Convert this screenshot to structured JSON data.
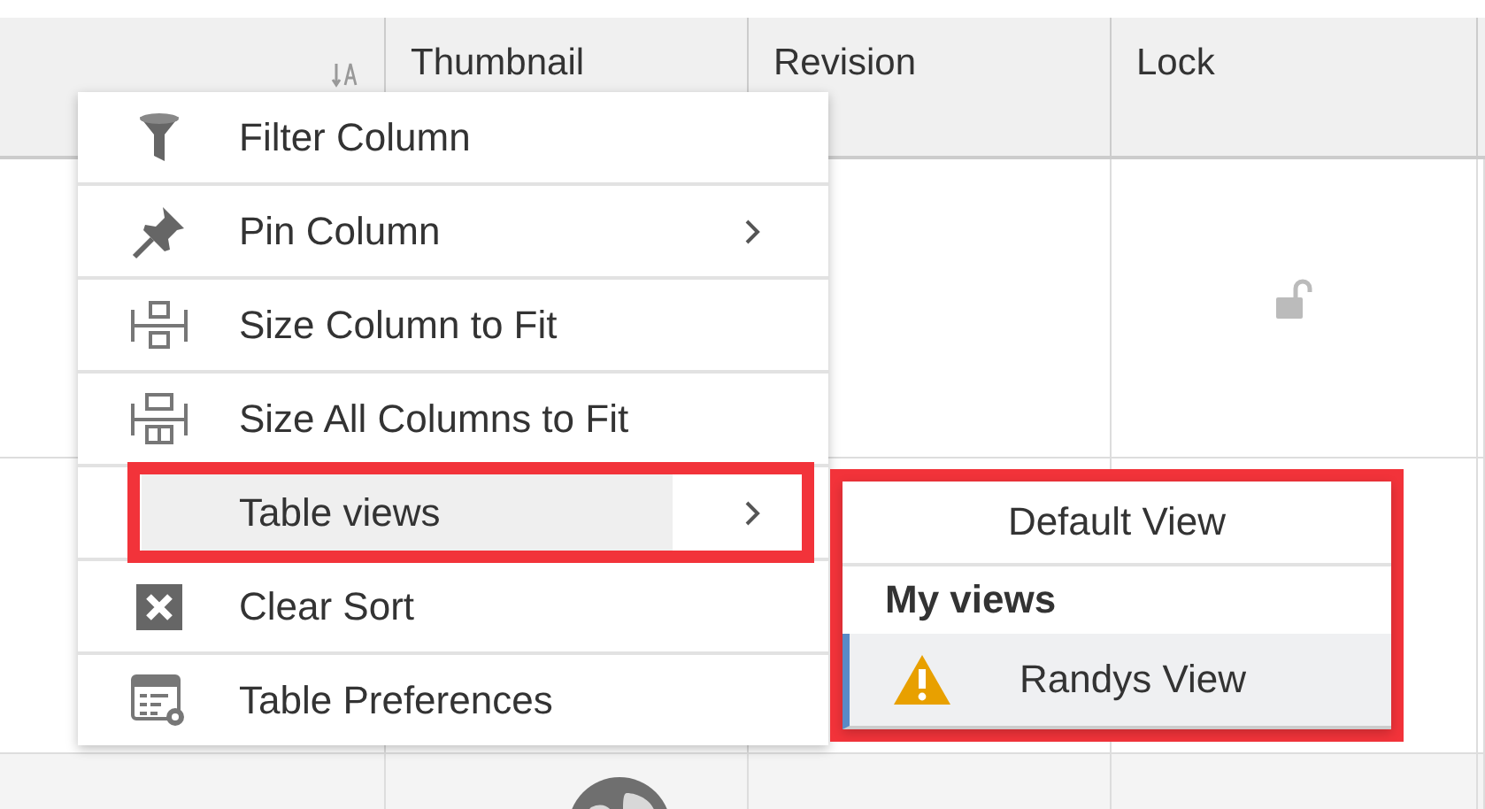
{
  "table": {
    "columns": [
      {
        "kind": "sort"
      },
      {
        "kind": "text",
        "label": "Thumbnail"
      },
      {
        "kind": "text",
        "label": "Revision"
      },
      {
        "kind": "text",
        "label": "Lock"
      }
    ],
    "rows": [
      {
        "kind": "unlocked"
      },
      {
        "kind": "blank"
      },
      {
        "kind": "globe"
      }
    ]
  },
  "context_menu": {
    "items": [
      {
        "kind": "filter",
        "label": "Filter Column",
        "submenu": false,
        "selected": false,
        "highlighted": false
      },
      {
        "kind": "pin",
        "label": "Pin Column",
        "submenu": true,
        "selected": false,
        "highlighted": false
      },
      {
        "kind": "size-column",
        "label": "Size Column to Fit",
        "submenu": false,
        "selected": false,
        "highlighted": false
      },
      {
        "kind": "size-all",
        "label": "Size All Columns to Fit",
        "submenu": false,
        "selected": false,
        "highlighted": false
      },
      {
        "kind": "none",
        "label": "Table views",
        "submenu": true,
        "selected": true,
        "highlighted": true
      },
      {
        "kind": "clear",
        "label": "Clear Sort",
        "submenu": false,
        "selected": false,
        "highlighted": false
      },
      {
        "kind": "preferences",
        "label": "Table Preferences",
        "submenu": false,
        "selected": false,
        "highlighted": false
      }
    ]
  },
  "submenu": {
    "highlighted": true,
    "items": [
      {
        "kind": "option",
        "label": "Default View",
        "selected": false,
        "warning": false
      },
      {
        "kind": "heading",
        "label": "My views"
      },
      {
        "kind": "option",
        "label": "Randys View",
        "selected": true,
        "warning": true
      }
    ]
  }
}
